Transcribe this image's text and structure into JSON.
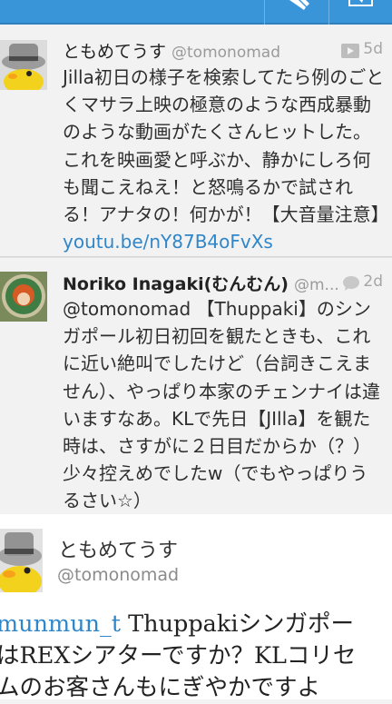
{
  "toolbar": {
    "compose_icon": "compose-icon",
    "edit_icon": "edit-icon"
  },
  "tweets": [
    {
      "name": "ともめてうす",
      "handle": "@tomonomad",
      "age": "5d",
      "age_icon": "video-icon",
      "text": "Jilla初日の様子を検索してたら例のごとくマサラ上映の極意のような西成暴動のような動画がたくさんヒットした。これを映画愛と呼ぶか、静かにしろ何も聞こえねえ！と怒鳴るかで試される！アナタの！何かが！【大音量注意】",
      "link": "youtu.be/nY87B4oFvXs"
    },
    {
      "name": "Noriko Inagaki(むんむん)",
      "handle": "@m...",
      "age": "2d",
      "age_icon": "reply-bubble-icon",
      "text": "@tomonomad 【Thuppaki】のシンガポール初日初回を観たときも、これに近い絶叫でしたけど（台詞きこえません）、やっぱり本家のチェンナイは違いますなあ。KLで先日【JIlla】を観た時は、さすがに２日目だからか（？）少々控えめでしたw（でもやっぱりうるさい☆）"
    }
  ],
  "detail": {
    "name": "ともめてうす",
    "handle": "@tomonomad",
    "mention": "munmun_t",
    "text": " Thuppakiシンガポー\nはREXシアターですか？KLコリセ\nムのお客さんもにぎやかですよ"
  },
  "colors": {
    "topbar": "#3a94d8",
    "link": "#2f86c9",
    "background": "#f2f2f2"
  }
}
